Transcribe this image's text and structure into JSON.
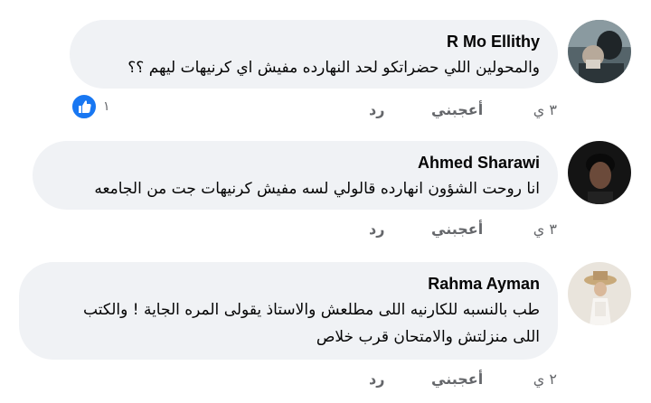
{
  "comments": [
    {
      "author": "R Mo Ellithy",
      "text": "والمحولين اللي حضراتكو لحد النهارده مفيش اي كرنيهات ليهم ؟؟",
      "time": "٣ ي",
      "like_label": "أعجبني",
      "reply_label": "رد",
      "reaction_count": "١",
      "reaction_icon": "like-icon",
      "avatar_colors": [
        "#3d4a4f",
        "#8a9aa0"
      ]
    },
    {
      "author": "Ahmed Sharawi",
      "text": "انا روحت الشؤون انهارده قالولي لسه مفيش كرنيهات جت من الجامعه",
      "time": "٣ ي",
      "like_label": "أعجبني",
      "reply_label": "رد",
      "avatar_colors": [
        "#141414",
        "#6b4a3a"
      ]
    },
    {
      "author": "Rahma Ayman",
      "text_lines": [
        "طب بالنسبه للكارنيه اللى مطلعش والاستاذ يقولى المره الجاية ! والكتب",
        "اللى منزلتش والامتحان قرب خلاص"
      ],
      "time": "٢ ي",
      "like_label": "أعجبني",
      "reply_label": "رد",
      "avatar_colors": [
        "#e9e4dc",
        "#c8a97a"
      ]
    }
  ],
  "colors": {
    "bubble": "#f0f2f5",
    "meta_text": "#65676b",
    "like_blue": "#1877f2"
  }
}
